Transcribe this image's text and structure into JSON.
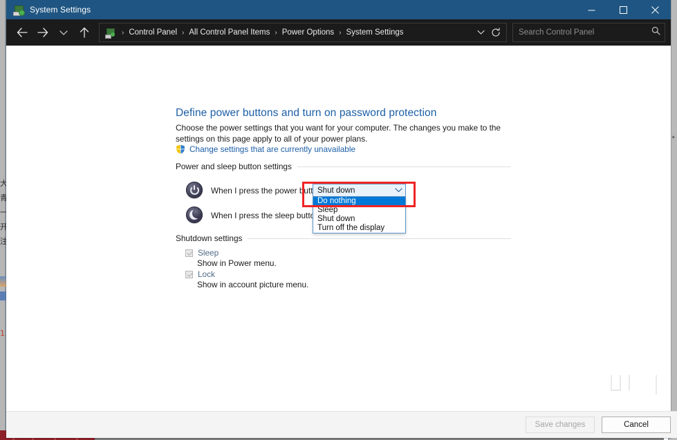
{
  "window": {
    "title": "System Settings",
    "title_icon": "system-settings-icon",
    "controls": {
      "minimize": "minimize-icon",
      "maximize": "maximize-icon",
      "close": "close-icon"
    }
  },
  "toolbar": {
    "back": "back-arrow-icon",
    "forward": "forward-arrow-icon",
    "recent": "chevron-down-icon",
    "up": "up-arrow-icon",
    "address_icon": "system-settings-icon",
    "breadcrumbs": [
      "Control Panel",
      "All Control Panel Items",
      "Power Options",
      "System Settings"
    ],
    "separator": "›",
    "history_chevron": "chevron-down-icon",
    "refresh": "refresh-icon",
    "search": {
      "placeholder": "Search Control Panel",
      "value": "",
      "icon": "search-icon"
    }
  },
  "page": {
    "heading": "Define power buttons and turn on password protection",
    "description": "Choose the power settings that you want for your computer. The changes you make to the settings on this page apply to all of your power plans.",
    "uac_link": "Change settings that are currently unavailable",
    "uac_icon": "uac-shield-icon"
  },
  "power_section": {
    "header": "Power and sleep button settings",
    "rows": [
      {
        "icon": "power-button-icon",
        "label": "When I press the power button:",
        "control": "power-button-combobox"
      },
      {
        "icon": "sleep-moon-icon",
        "label": "When I press the sleep button:",
        "control": "sleep-button-combobox"
      }
    ]
  },
  "combobox": {
    "name": "power-button-action-select",
    "value": "Shut down",
    "expanded": true,
    "chevron": "chevron-down-icon",
    "options": [
      {
        "label": "Do nothing",
        "selected": true
      },
      {
        "label": "Sleep",
        "selected": false
      },
      {
        "label": "Shut down",
        "selected": false
      },
      {
        "label": "Turn off the display",
        "selected": false
      }
    ],
    "highlight_color": "#0078d7",
    "annotation_color": "#ef2424"
  },
  "shutdown_section": {
    "header": "Shutdown settings",
    "items": [
      {
        "label": "Sleep",
        "sublabel": "Show in Power menu.",
        "checked": true,
        "disabled": true
      },
      {
        "label": "Lock",
        "sublabel": "Show in account picture menu.",
        "checked": true,
        "disabled": true
      }
    ]
  },
  "footer": {
    "save_label": "Save changes",
    "save_disabled": true,
    "cancel_label": "Cancel",
    "cancel_disabled": false
  },
  "watermark": {
    "url": "www.chiphell.com",
    "logo": "chiphell-logo"
  },
  "colors": {
    "titlebar": "#1f5582",
    "toolbar": "#1b1b1b",
    "link": "#1b5ea6",
    "accent": "#0078d7",
    "annotation": "#ef2424"
  }
}
